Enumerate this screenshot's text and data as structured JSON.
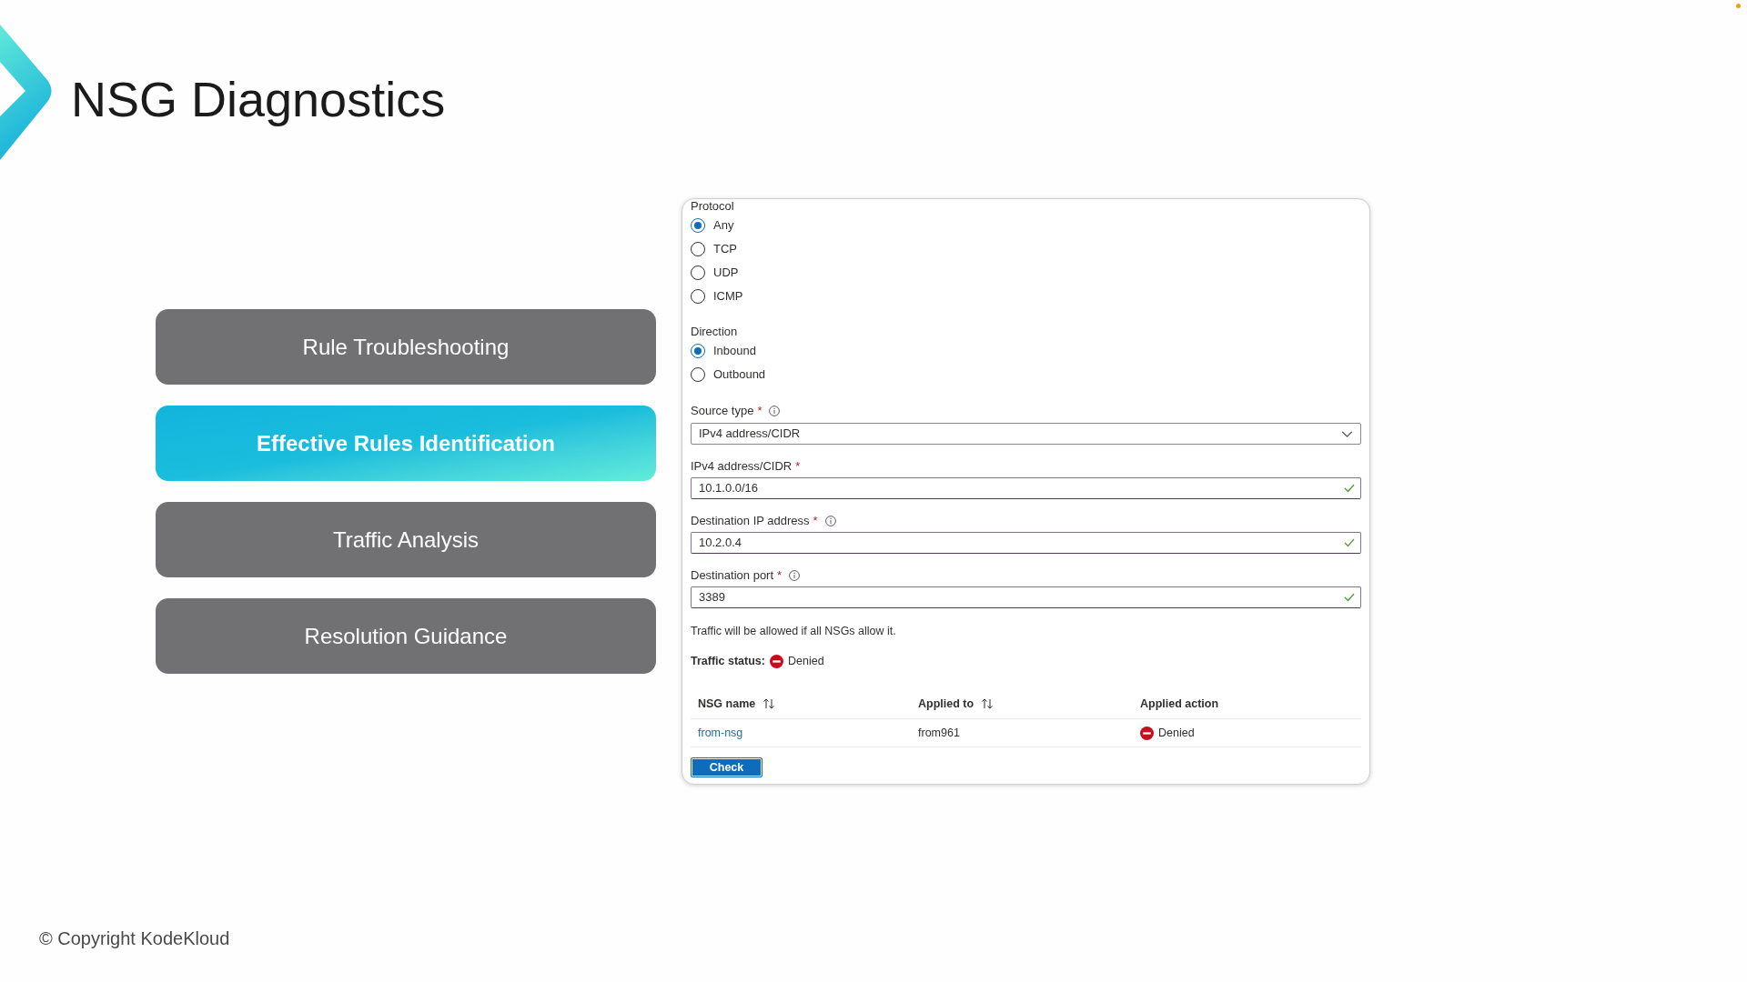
{
  "header": {
    "title": "NSG Diagnostics"
  },
  "topics": [
    {
      "label": "Rule Troubleshooting",
      "selected": false
    },
    {
      "label": "Effective Rules Identification",
      "selected": true
    },
    {
      "label": "Traffic Analysis",
      "selected": false
    },
    {
      "label": "Resolution Guidance",
      "selected": false
    }
  ],
  "form": {
    "radio_groups": [
      {
        "label": "Protocol",
        "options": [
          {
            "label": "Any",
            "selected": true
          },
          {
            "label": "TCP",
            "selected": false
          },
          {
            "label": "UDP",
            "selected": false
          },
          {
            "label": "ICMP",
            "selected": false
          }
        ]
      },
      {
        "label": "Direction",
        "options": [
          {
            "label": "Inbound",
            "selected": true
          },
          {
            "label": "Outbound",
            "selected": false
          }
        ]
      }
    ],
    "fields": [
      {
        "kind": "select",
        "label": "Source type",
        "required_mark": "*",
        "info": true,
        "value": "IPv4 address/CIDR"
      },
      {
        "kind": "input",
        "label": "IPv4 address/CIDR",
        "required_mark": "*",
        "info": false,
        "value": "10.1.0.0/16",
        "valid": true
      },
      {
        "kind": "input",
        "label": "Destination IP address",
        "required_mark": "*",
        "info": true,
        "value": "10.2.0.4",
        "valid": true
      },
      {
        "kind": "input",
        "label": "Destination port",
        "required_mark": "*",
        "info": true,
        "value": "3389",
        "valid": true
      }
    ],
    "note": "Traffic will be allowed if all NSGs allow it.",
    "traffic_status": {
      "label": "Traffic status:",
      "kind": "denied",
      "value": "Denied"
    },
    "table": {
      "columns": [
        {
          "label": "NSG name",
          "sortable": true
        },
        {
          "label": "Applied to",
          "sortable": true
        },
        {
          "label": "Applied action",
          "sortable": false
        }
      ],
      "rows": [
        {
          "nsg_name": "from-nsg",
          "applied_to": "from961",
          "applied_action": {
            "kind": "denied",
            "value": "Denied"
          }
        }
      ]
    },
    "check_button": "Check"
  },
  "footer": {
    "copyright": "© Copyright KodeKloud"
  }
}
